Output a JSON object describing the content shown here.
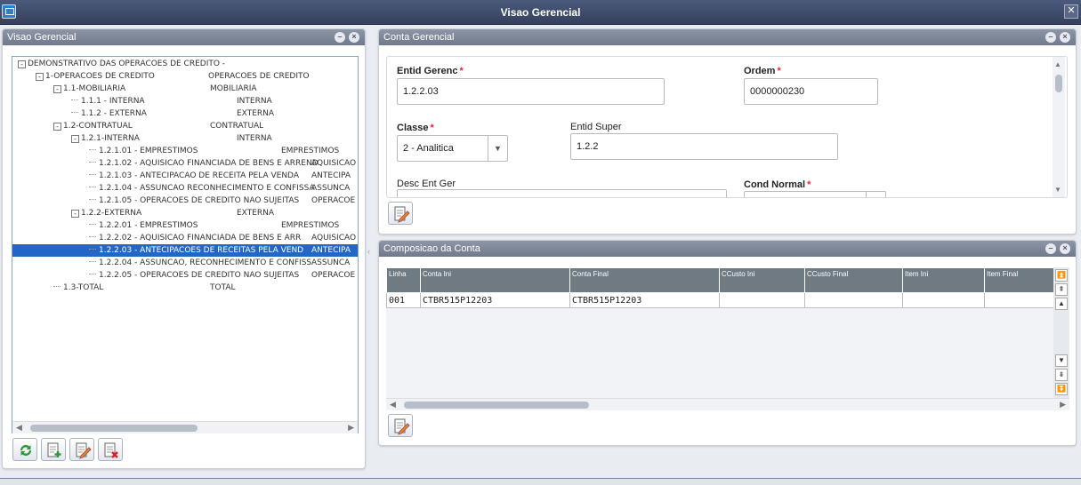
{
  "window": {
    "title": "Visao Gerencial"
  },
  "left_panel": {
    "title": "Visao Gerencial",
    "tree": [
      {
        "code": "DEMONSTRATIVO DAS OPERACOES DE CREDITO -",
        "desc": "",
        "level": 0,
        "toggle": "-",
        "selected": false
      },
      {
        "code": "1-OPERACOES DE CREDITO",
        "desc": "OPERACOES DE CREDITO",
        "level": 1,
        "toggle": "-",
        "selected": false
      },
      {
        "code": "1.1-MOBILIARIA",
        "desc": "MOBILIARIA",
        "level": 2,
        "toggle": "-",
        "selected": false
      },
      {
        "code": "1.1.1 - INTERNA",
        "desc": "INTERNA",
        "level": 3,
        "toggle": "",
        "selected": false
      },
      {
        "code": "1.1.2 - EXTERNA",
        "desc": "EXTERNA",
        "level": 3,
        "toggle": "",
        "selected": false
      },
      {
        "code": "1.2-CONTRATUAL",
        "desc": "CONTRATUAL",
        "level": 2,
        "toggle": "-",
        "selected": false
      },
      {
        "code": "1.2.1-INTERNA",
        "desc": "INTERNA",
        "level": 3,
        "toggle": "-",
        "selected": false
      },
      {
        "code": "1.2.1.01 - EMPRESTIMOS",
        "desc": "EMPRESTIMOS",
        "level": 4,
        "toggle": "",
        "selected": false
      },
      {
        "code": "1.2.1.02 - AQUISICAO FINANCIADA DE BENS E ARREND",
        "desc": "AQUISICAO",
        "level": 4,
        "toggle": "",
        "selected": false
      },
      {
        "code": "1.2.1.03 - ANTECIPACAO DE RECEITA PELA VENDA",
        "desc": "ANTECIPA",
        "level": 4,
        "toggle": "",
        "selected": false
      },
      {
        "code": "1.2.1.04 - ASSUNCAO RECONHECIMENTO E CONFISSA",
        "desc": "ASSUNCA",
        "level": 4,
        "toggle": "",
        "selected": false
      },
      {
        "code": "1.2.1.05 - OPERACOES DE CREDITO NAO SUJEITAS",
        "desc": "OPERACOE",
        "level": 4,
        "toggle": "",
        "selected": false
      },
      {
        "code": "1.2.2-EXTERNA",
        "desc": "EXTERNA",
        "level": 3,
        "toggle": "-",
        "selected": false
      },
      {
        "code": "1.2.2.01 - EMPRESTIMOS",
        "desc": "EMPRESTIMOS",
        "level": 4,
        "toggle": "",
        "selected": false
      },
      {
        "code": "1.2.2.02 - AQUISICAO FINANCIADA DE BENS E ARR",
        "desc": "AQUISICAO I",
        "level": 4,
        "toggle": "",
        "selected": false
      },
      {
        "code": "1.2.2.03 - ANTECIPACOES DE RECEITAS PELA VEND",
        "desc": "ANTECIPA",
        "level": 4,
        "toggle": "",
        "selected": true
      },
      {
        "code": "1.2.2.04 - ASSUNCAO, RECONHECIMENTO E CONFISS",
        "desc": "ASSUNCA",
        "level": 4,
        "toggle": "",
        "selected": false
      },
      {
        "code": "1.2.2.05 - OPERACOES DE CREDITO NAO SUJEITAS",
        "desc": "OPERACOE",
        "level": 4,
        "toggle": "",
        "selected": false
      },
      {
        "code": "1.3-TOTAL",
        "desc": "TOTAL",
        "level": 2,
        "toggle": "",
        "selected": false
      }
    ]
  },
  "conta_panel": {
    "title": "Conta Gerencial",
    "entid_gerenc": {
      "label": "Entid Gerenc",
      "value": "1.2.2.03"
    },
    "ordem": {
      "label": "Ordem",
      "value": "0000000230"
    },
    "classe": {
      "label": "Classe",
      "value": "2 - Analitica"
    },
    "entid_super": {
      "label": "Entid Super",
      "value": "1.2.2"
    },
    "desc_ent_ger": {
      "label": "Desc Ent Ger",
      "value": ""
    },
    "cond_normal": {
      "label": "Cond Normal",
      "value": ""
    },
    "required_mark": "*"
  },
  "composicao_panel": {
    "title": "Composicao da Conta",
    "columns": [
      "Linha",
      "Conta Ini",
      "Conta Final",
      "CCusto Ini",
      "CCusto Final",
      "Item Ini",
      "Item Final"
    ],
    "rows": [
      [
        "001",
        "CTBR515P12203",
        "CTBR515P12203",
        "",
        "",
        "",
        ""
      ]
    ]
  },
  "colors": {
    "selection": "#2067c6",
    "header": "#707a8c",
    "grid_header": "#6f7a83",
    "required": "#ee2233"
  }
}
